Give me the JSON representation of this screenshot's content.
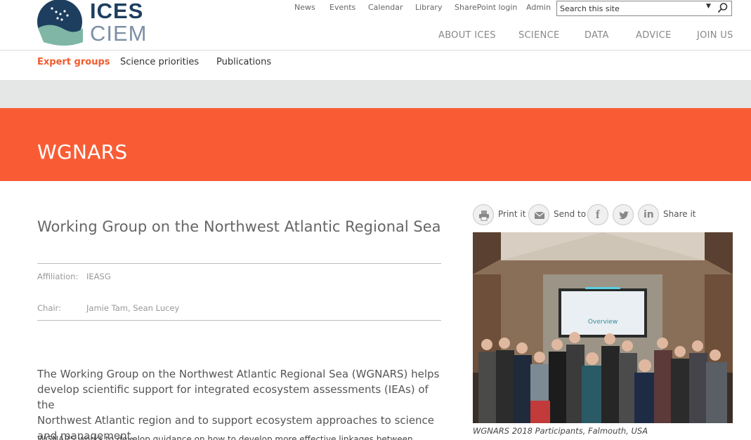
{
  "logo": {
    "line1": "ICES",
    "line2": "CIEM"
  },
  "utility_nav": [
    "News",
    "Events",
    "Calendar",
    "Library",
    "SharePoint login",
    "Admin"
  ],
  "search": {
    "placeholder": "Search this site"
  },
  "main_nav": [
    "ABOUT ICES",
    "SCIENCE",
    "DATA",
    "ADVICE",
    "JOIN US"
  ],
  "sub_nav": {
    "active": "Expert groups",
    "items": [
      "Science priorities",
      "Publications"
    ]
  },
  "hero": {
    "title": "WGNARS"
  },
  "content": {
    "title": "Working Group on the Northwest Atlantic Regional Sea",
    "affiliation_label": "Affiliation:",
    "affiliation_value": "IEASG",
    "chair_label": "Chair:",
    "chair_value": "Jamie Tam, Sean Lucey",
    "intro_line1": "The Working Group on the Northwest Atlantic Regional Sea (WGNARS) helps",
    "intro_line2": "develop scientific support for integrated ecosystem assessments (IEAs) of the",
    "intro_line3": "Northwest Atlantic region and to support ecosystem approaches to science",
    "intro_line4": "and management.",
    "more_text": "WGNARS works to develop guidance on how to develop more effective linkages between"
  },
  "share": {
    "print_label": "Print it",
    "send_label": "Send to",
    "share_label": "Share it",
    "icons": [
      "print-icon",
      "email-icon",
      "facebook-icon",
      "twitter-icon",
      "linkedin-icon"
    ]
  },
  "photo": {
    "screen_text": "Overview",
    "caption": "WGNARS 2018 Participants, Falmouth, USA"
  },
  "colors": {
    "accent": "#f95c35",
    "active_nav": "#f15a2b",
    "logo_dark": "#1d3e5f",
    "band": "#e5e6e6"
  }
}
